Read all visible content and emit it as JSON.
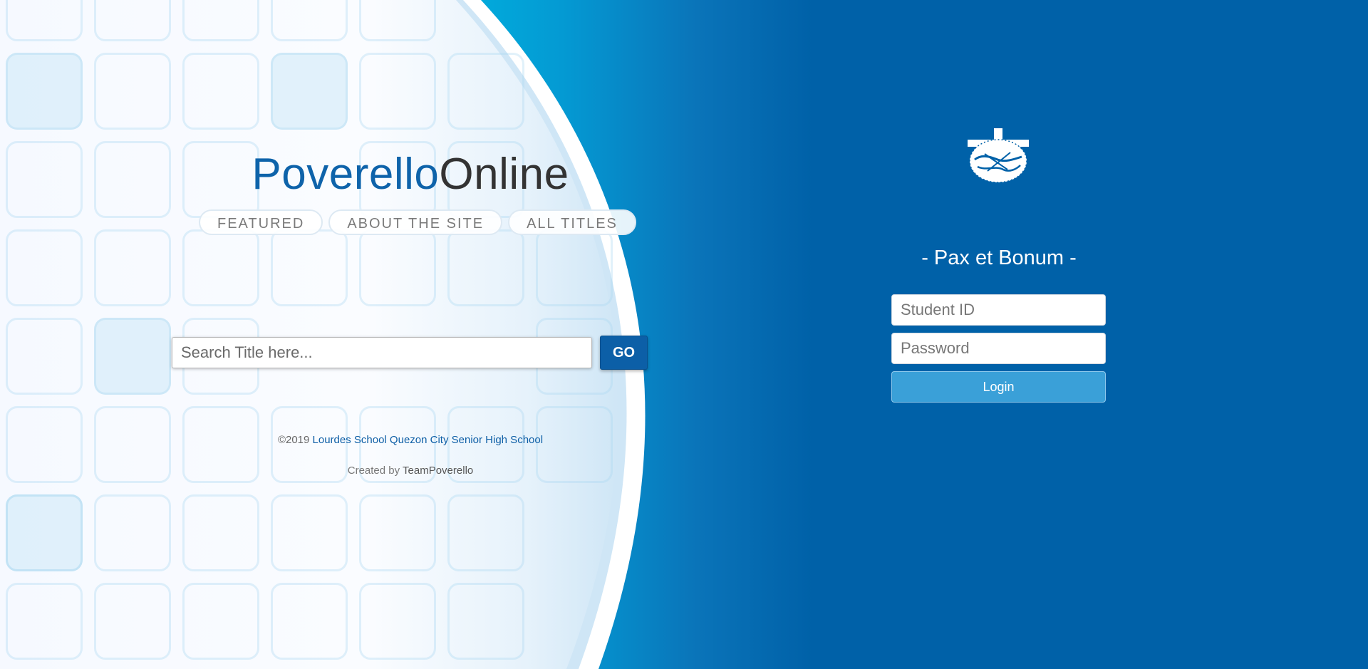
{
  "brand": {
    "part1": "Poverello",
    "part2": "Online"
  },
  "tabs": [
    {
      "label": "FEATURED"
    },
    {
      "label": "ABOUT THE SITE"
    },
    {
      "label": "ALL TITLES"
    }
  ],
  "search": {
    "placeholder": "Search Title here...",
    "button_label": "GO"
  },
  "footer": {
    "copyright_prefix": "©2019",
    "school_link": "Lourdes School Quezon City Senior High School",
    "created_by": "Created by",
    "team": "TeamPoverello"
  },
  "login": {
    "logo_icon": "crucifix-globe-logo-icon",
    "motto": "- Pax et Bonum -",
    "student_id_placeholder": "Student ID",
    "password_placeholder": "Password",
    "button_label": "Login"
  },
  "colors": {
    "brand_blue": "#0e63aa",
    "right_panel": "#0061a8",
    "login_button": "#3aa0d8",
    "go_button": "#0c5fa7"
  }
}
